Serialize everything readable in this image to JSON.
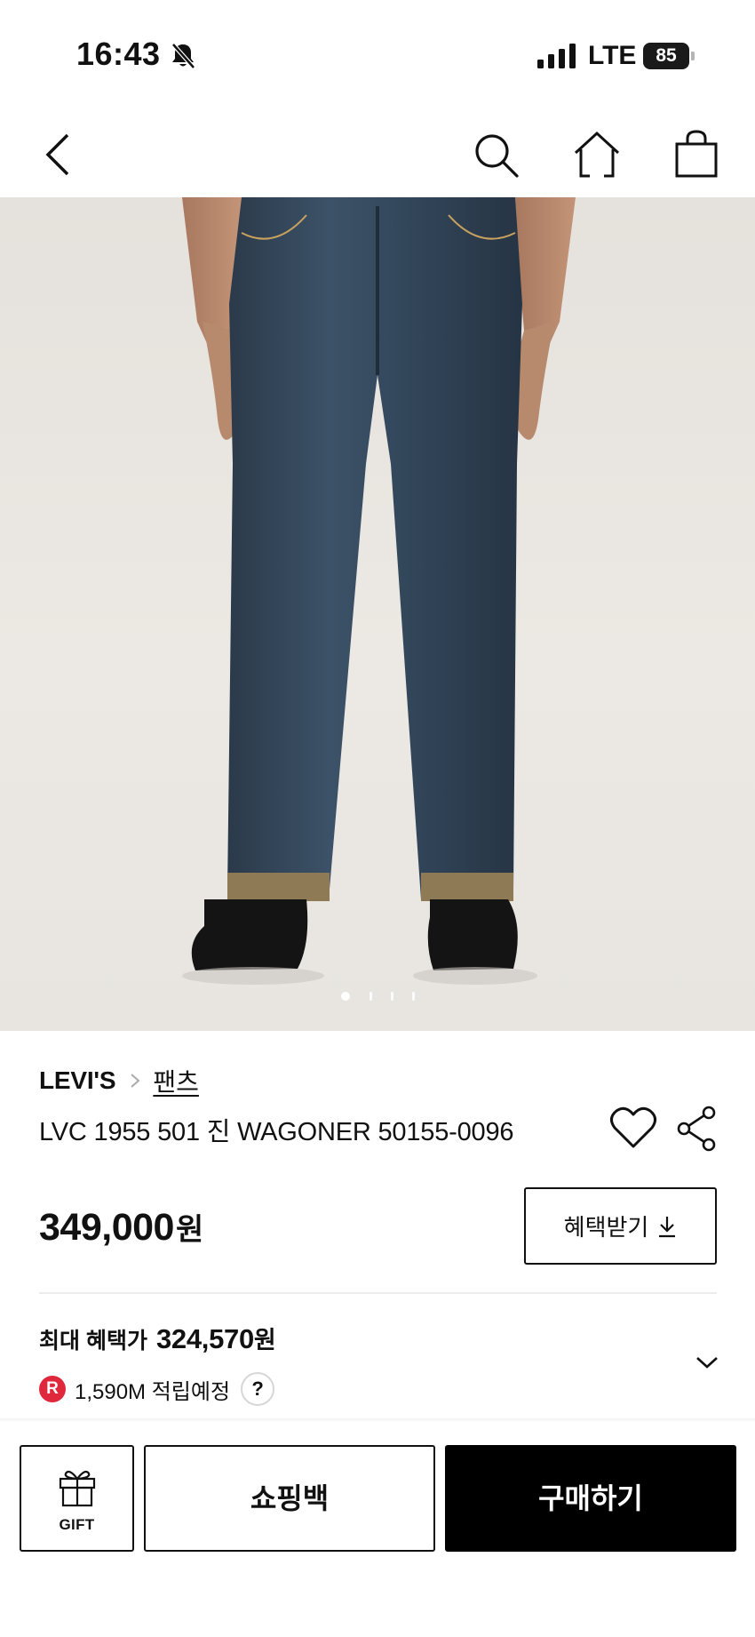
{
  "status_bar": {
    "time": "16:43",
    "network": "LTE",
    "battery": "85"
  },
  "nav": {
    "back_icon": "chevron-left-icon",
    "search_icon": "search-icon",
    "home_icon": "home-icon",
    "cart_icon": "shopping-bag-icon"
  },
  "gallery": {
    "total_slides": 4,
    "current_slide": 1
  },
  "product": {
    "brand": "LEVI'S",
    "category": "팬츠",
    "title": "LVC 1955 501 진 WAGONER 50155-0096",
    "price": "349,000",
    "currency": "원",
    "benefit_button": "혜택받기",
    "max_benefit_label": "최대 혜택가",
    "max_benefit_price": "324,570",
    "points_badge": "R",
    "points_text": "1,590M 적립예정",
    "help_label": "?"
  },
  "bottom_bar": {
    "gift_label": "GIFT",
    "bag_label": "쇼핑백",
    "buy_label": "구매하기"
  },
  "colors": {
    "accent_black": "#000000",
    "points_red": "#e0283c"
  }
}
